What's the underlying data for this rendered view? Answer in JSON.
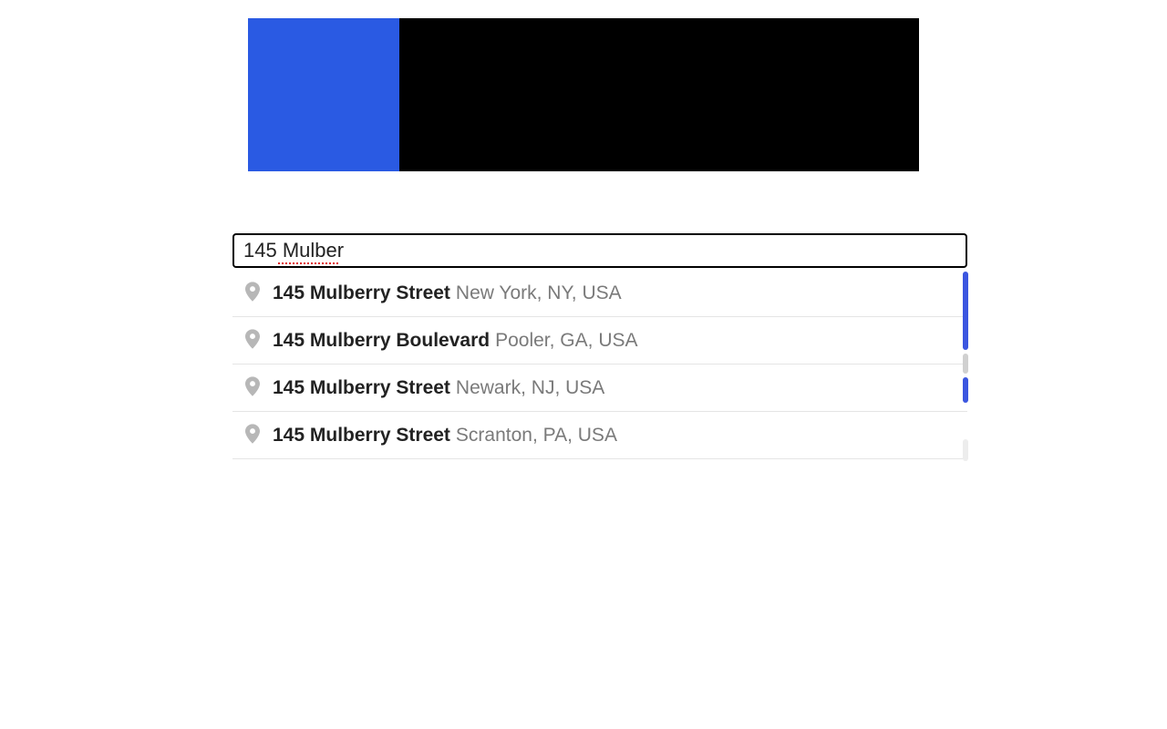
{
  "search": {
    "value": "145 Mulber"
  },
  "suggestions": [
    {
      "main": "145 Mulberry Street",
      "secondary": "New York, NY, USA"
    },
    {
      "main": "145 Mulberry Boulevard",
      "secondary": "Pooler, GA, USA"
    },
    {
      "main": "145 Mulberry Street",
      "secondary": "Newark, NJ, USA"
    },
    {
      "main": "145 Mulberry Street",
      "secondary": "Scranton, PA, USA"
    }
  ]
}
